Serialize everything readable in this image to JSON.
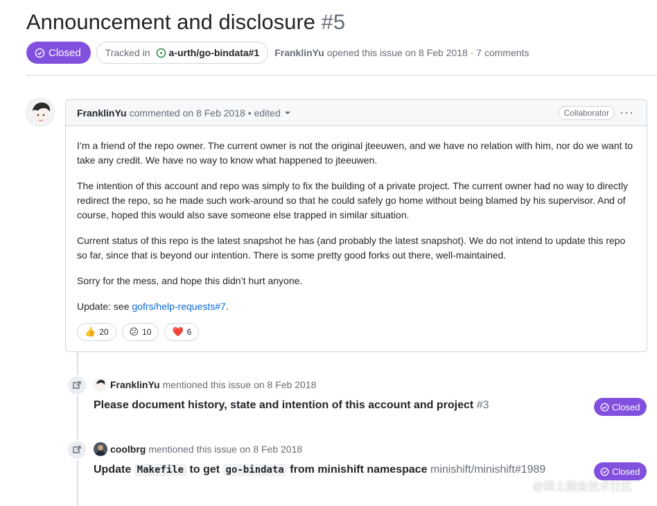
{
  "issue": {
    "title": "Announcement and disclosure",
    "number": "#5",
    "state": "Closed",
    "tracked_label": "Tracked in",
    "tracked_ref": "a-urth/go-bindata#1",
    "author": "FranklinYu",
    "opened_text": "opened this issue on 8 Feb 2018 · 7 comments"
  },
  "comment": {
    "author": "FranklinYu",
    "meta": "commented on 8 Feb 2018 • edited",
    "badge": "Collaborator",
    "menu": "···",
    "paragraphs": [
      "I’m a friend of the repo owner. The current owner is not the original jteeuwen, and we have no relation with him, nor do we want to take any credit. We have no way to know what happened to jteeuwen.",
      "The intention of this account and repo was simply to fix the building of a private project. The current owner had no way to directly redirect the repo, so he made such work-around so that he could safely go home without being blamed by his supervisor. And of course, hoped this would also save someone else trapped in similar situation.",
      "Current status of this repo is the latest snapshot he has (and probably the latest snapshot). We do not intend to update this repo so far, since that is beyond our intention. There is some pretty good forks out there, well-maintained.",
      "Sorry for the mess, and hope this didn’t hurt anyone."
    ],
    "update_prefix": "Update: see ",
    "update_link": "gofrs/help-requests#7",
    "update_suffix": ".",
    "reactions": [
      {
        "emoji": "👍",
        "icon": "thumbs-up-icon",
        "count": "20"
      },
      {
        "emoji": "😕",
        "icon": "confused-face-icon",
        "count": "10"
      },
      {
        "emoji": "❤️",
        "icon": "heart-icon",
        "count": "6"
      }
    ]
  },
  "events": [
    {
      "who": "FranklinYu",
      "action": "mentioned this issue on 8 Feb 2018",
      "title": "Please document history, state and intention of this account and project",
      "ref": "#3",
      "state": "Closed"
    },
    {
      "who": "coolbrg",
      "action": "mentioned this issue on 8 Feb 2018",
      "title_parts": [
        "Update ",
        "Makefile",
        " to get ",
        "go-bindata",
        " from minishift namespace"
      ],
      "ref": "minishift/minishift#1989",
      "state": "Closed"
    }
  ],
  "watermark": "@稀土掘金技术社区",
  "colors": {
    "closed_purple": "#8250df",
    "link_blue": "#0969da",
    "open_green": "#1a7f37",
    "muted_text": "#656d76"
  }
}
